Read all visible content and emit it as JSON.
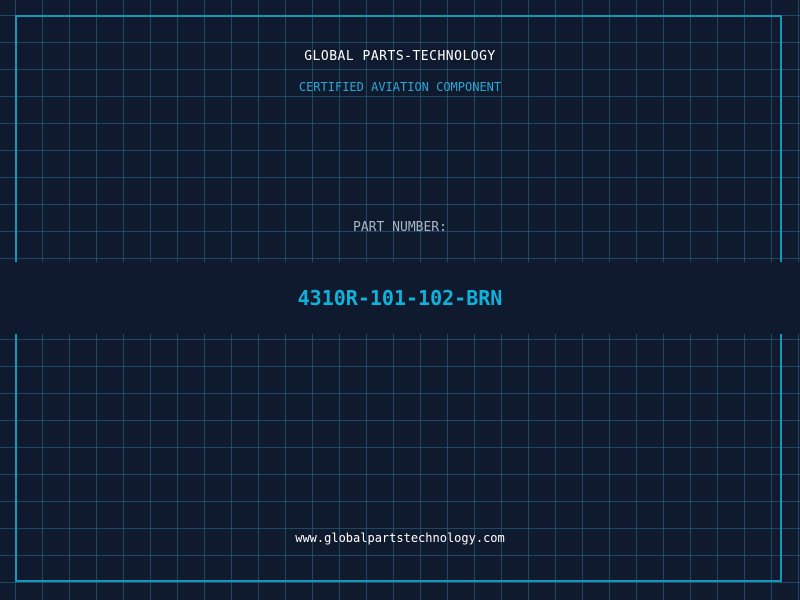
{
  "header": {
    "brand": "GLOBAL PARTS-TECHNOLOGY",
    "tagline": "CERTIFIED AVIATION COMPONENT"
  },
  "part": {
    "label": "PART NUMBER:",
    "number": "4310R-101-102-BRN"
  },
  "footer": {
    "website": "www.globalpartstechnology.com"
  },
  "colors": {
    "background": "#101a2e",
    "grid": "#2b6e8c",
    "frame": "#1596bd",
    "accent": "#0fb2da",
    "tagline": "#2aa8d8"
  }
}
